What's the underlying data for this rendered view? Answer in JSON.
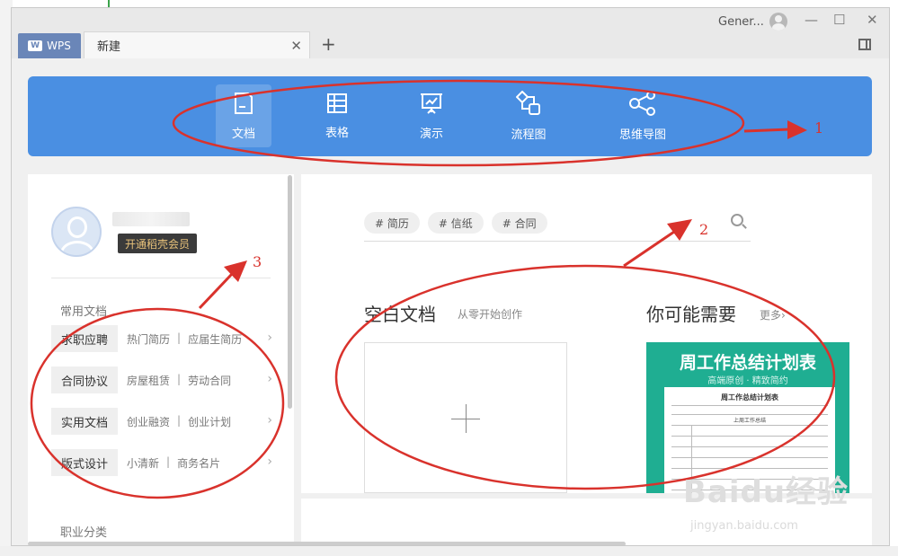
{
  "window": {
    "user_name": "Gener...",
    "wps_tab": "WPS",
    "wps_logo": "W",
    "active_tab": "新建",
    "close_symbol": "✕",
    "add_symbol": "+",
    "minimize_symbol": "—",
    "maximize_symbol": "☐",
    "exit_symbol": "✕"
  },
  "toolbar": {
    "items": [
      {
        "label": "文档",
        "icon": "document-icon",
        "active": true
      },
      {
        "label": "表格",
        "icon": "table-icon",
        "active": false
      },
      {
        "label": "演示",
        "icon": "presentation-icon",
        "active": false
      },
      {
        "label": "流程图",
        "icon": "flowchart-icon",
        "active": false
      },
      {
        "label": "思维导图",
        "icon": "mindmap-icon",
        "active": false
      }
    ]
  },
  "profile": {
    "vip_label": "开通稻壳会员"
  },
  "sidebar": {
    "common_title": "常用文档",
    "career_title": "职业分类",
    "categories": [
      {
        "label": "求职应聘",
        "link1": "热门简历",
        "link2": "应届生简历"
      },
      {
        "label": "合同协议",
        "link1": "房屋租赁",
        "link2": "劳动合同"
      },
      {
        "label": "实用文档",
        "link1": "创业融资",
        "link2": "创业计划"
      },
      {
        "label": "版式设计",
        "link1": "小清新",
        "link2": "商务名片"
      }
    ],
    "separator": "|",
    "arrow": "›"
  },
  "main": {
    "tags": [
      "# 简历",
      "# 信纸",
      "# 合同"
    ],
    "blank_title": "空白文档",
    "blank_subtitle": "从零开始创作",
    "need_title": "你可能需要",
    "more_label": "更多›",
    "template": {
      "title": "周工作总结计划表",
      "subtitle": "高端原创 · 精致简约",
      "sheet_title": "周工作总结计划表",
      "sheet_section": "上周工作总结"
    }
  },
  "annotations": {
    "labels": [
      "1",
      "2",
      "3"
    ],
    "color": "#d9322c"
  },
  "watermark": {
    "text": "Baidu经验",
    "url": "jingyan.baidu.com"
  },
  "colors": {
    "toolbar_bg": "#4a8fe2",
    "template_bg": "#1fae92",
    "vip_bg": "#3b3b3b"
  }
}
